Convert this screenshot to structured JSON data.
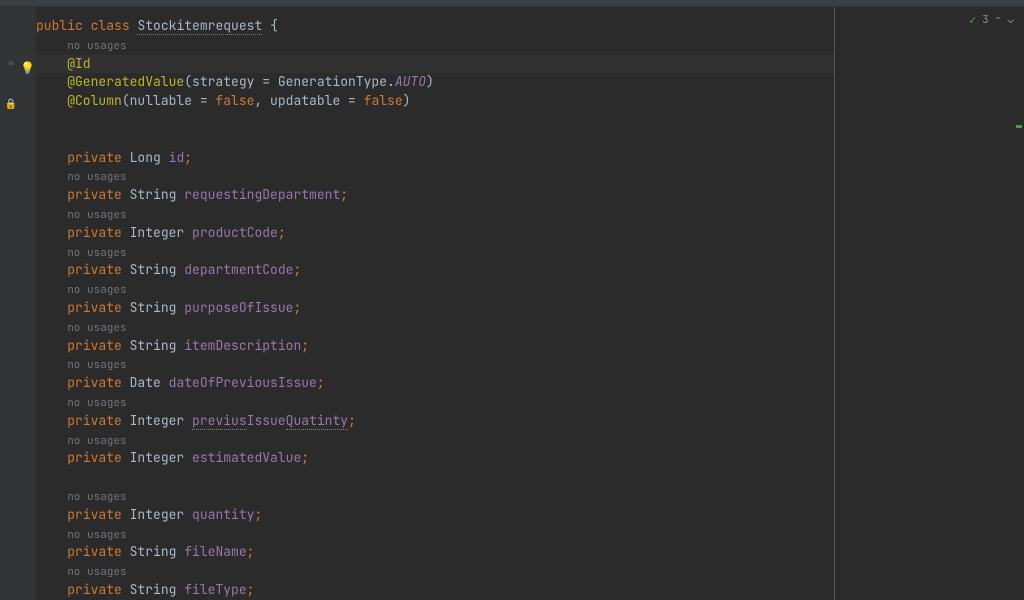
{
  "status": {
    "check_icon": "✓",
    "count": "3",
    "chev_up": "⌃",
    "chev_down": "⌄"
  },
  "code": {
    "kw_public": "public",
    "kw_class": "class",
    "kw_private": "private",
    "kw_false": "false",
    "classname": "Stockitemrequest",
    "brace_open": "{",
    "no_usages": "no usages",
    "anno_id": "@Id",
    "anno_gen": "@GeneratedValue",
    "anno_col": "@Column",
    "gen_args_1": "(strategy = GenerationType.",
    "gen_auto": "AUTO",
    "gen_args_2": ")",
    "col_args_1": "(nullable = ",
    "col_args_2": ", updatable = ",
    "col_args_3": ")",
    "type_long": "Long",
    "type_string": "String",
    "type_integer": "Integer",
    "type_date": "Date",
    "f_id": "id",
    "f_reqdept": "requestingDepartment",
    "f_prodcode": "productCode",
    "f_deptcode": "departmentCode",
    "f_purpose": "purposeOfIssue",
    "f_itemdesc": "itemDescription",
    "f_dateprev": "dateOfPreviousIssue",
    "f_previsq_1": "previus",
    "f_previsq_2": "Issue",
    "f_previsq_3": "Quatinty",
    "f_estval": "estimatedValue",
    "f_qty": "quantity",
    "f_fname": "fileName",
    "f_ftype": "fileType",
    "semi": ";"
  }
}
